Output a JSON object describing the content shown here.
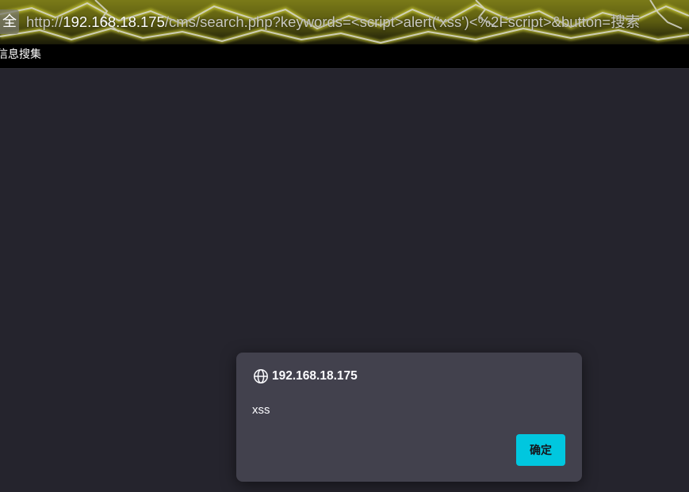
{
  "toolbar": {
    "security_chip_label": "全",
    "url": {
      "scheme": "http://",
      "host": "192.168.18.175",
      "path": "/cms/search.php?keywords=<script>alert('xss')<%2Fscript>&button=搜索"
    }
  },
  "bookmarks": {
    "items": [
      {
        "label": "信息搜集"
      }
    ]
  },
  "dialog": {
    "icon": "globe-icon",
    "origin": "192.168.18.175",
    "message": "xss",
    "ok_label": "确定"
  },
  "colors": {
    "page_background": "#25242d",
    "dialog_background": "#42414d",
    "ok_button": "#00c7df",
    "theme_accent": "#c8c800"
  }
}
